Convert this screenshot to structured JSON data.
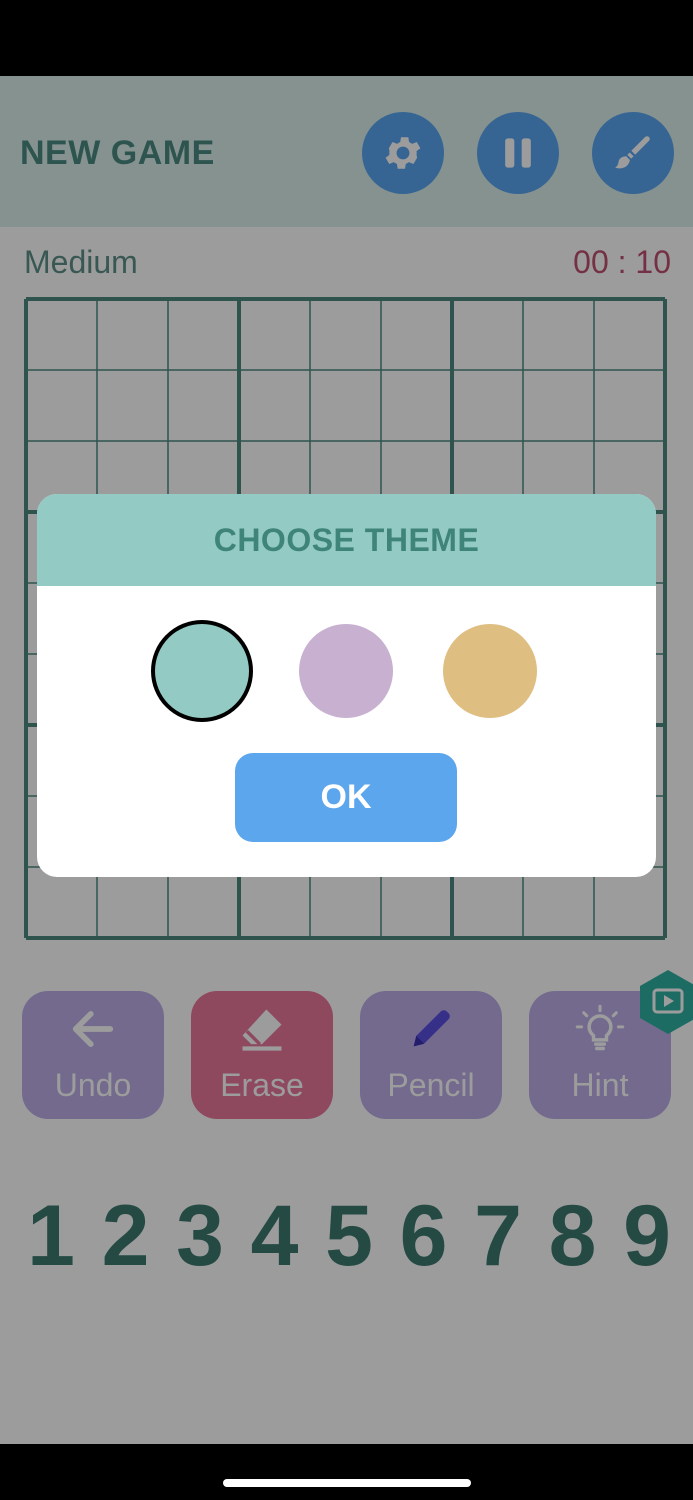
{
  "header": {
    "title": "NEW GAME"
  },
  "status": {
    "difficulty": "Medium",
    "timer": "00 : 10"
  },
  "tools": [
    {
      "label": "Undo",
      "icon": "arrow-left-icon",
      "color": "#bdaee8"
    },
    {
      "label": "Erase",
      "icon": "eraser-icon",
      "color": "#e9789b"
    },
    {
      "label": "Pencil",
      "icon": "pencil-icon",
      "color": "#bdaee8"
    },
    {
      "label": "Hint",
      "icon": "lightbulb-icon",
      "color": "#bdaee8"
    }
  ],
  "numbers": [
    "1",
    "2",
    "3",
    "4",
    "5",
    "6",
    "7",
    "8",
    "9"
  ],
  "dialog": {
    "title": "CHOOSE THEME",
    "themes": [
      {
        "color": "#93cac3",
        "selected": true
      },
      {
        "color": "#c7b0d0",
        "selected": false
      },
      {
        "color": "#dfbe82",
        "selected": false
      }
    ],
    "ok_label": "OK"
  },
  "colors": {
    "accent": "#5aa6f0",
    "grid": "#4e8a80",
    "timer": "#c0516f"
  }
}
